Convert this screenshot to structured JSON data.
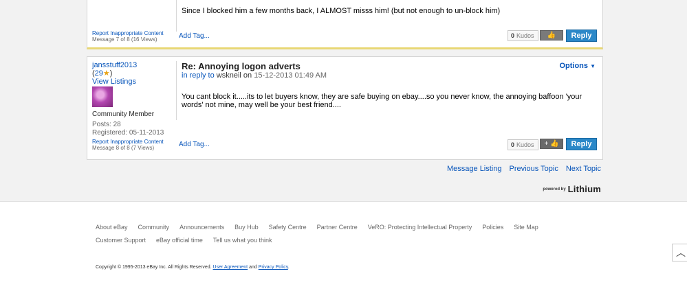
{
  "post1": {
    "body": "Since I blocked him a few months back, I ALMOST misss him! (but not enough to un-block him)",
    "report_link": "Report Inappropriate Content",
    "message_info": "Message 7 of 8 (16 Views)",
    "add_tag": "Add Tag...",
    "kudos_count": "0",
    "kudos_label": "Kudos",
    "reply": "Reply"
  },
  "post2": {
    "author": "jansstuff2013",
    "rank_count": "29",
    "view_listings": "View Listings",
    "role": "Community Member",
    "posts": "Posts: 28",
    "registered": "Registered: 05-11-2013",
    "report_link": "Report Inappropriate Content",
    "message_info": "Message 8 of 8 (7 Views)",
    "subject": "Re: Annoying logon adverts",
    "in_reply_to": "in reply to",
    "reply_user": "wskneil",
    "date_prefix": "on",
    "date": "15-12-2013 01:49 AM",
    "options": "Options",
    "body": "You cant block it.....its to let buyers know, they are safe buying on ebay....so you never know, the annoying baffoon 'your words' not mine, may well be your best friend....",
    "add_tag": "Add Tag...",
    "kudos_count": "0",
    "kudos_label": "Kudos",
    "reply": "Reply"
  },
  "navigation": {
    "message_listing": "Message Listing",
    "previous_topic": "Previous Topic",
    "next_topic": "Next Topic"
  },
  "powered": {
    "small": "powered by",
    "brand": "Lithium"
  },
  "footer": {
    "row1": [
      "About eBay",
      "Community",
      "Announcements",
      "Buy Hub",
      "Safety Centre",
      "Partner Centre",
      "VeRO: Protecting Intellectual Property",
      "Policies",
      "Site Map"
    ],
    "row2": [
      "Customer Support",
      "eBay official time",
      "Tell us what you think"
    ],
    "copyright_prefix": "Copyright © 1995-2013 eBay Inc. All Rights Reserved.",
    "user_agreement": "User Agreement",
    "and": "and",
    "privacy_policy": "Privacy Policy",
    "period": "."
  },
  "icons": {
    "thumbs_up": "thumbs-up-icon",
    "star": "star-icon",
    "chevron": "chevron-down-icon",
    "scroll_top": "chevron-up-icon"
  },
  "colors": {
    "link": "#0654ba",
    "reply_button": "#2b88c8",
    "accent_border": "#e8d774"
  }
}
